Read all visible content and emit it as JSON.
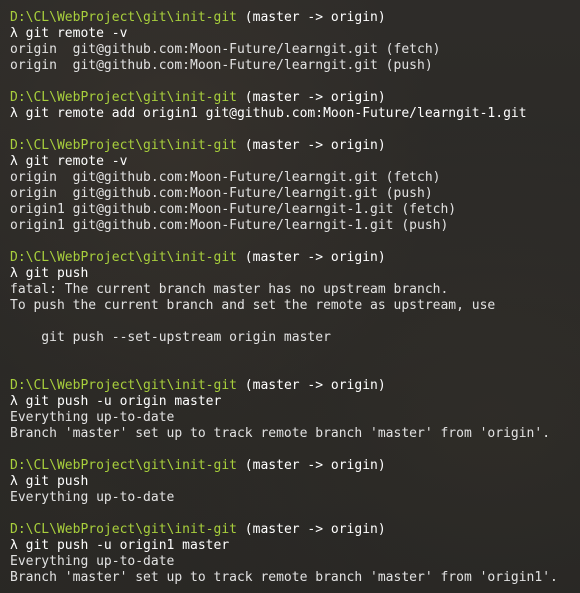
{
  "colors": {
    "background": "#2b2a28",
    "prompt_path": "#a8cf3c",
    "text": "#e8e8e8"
  },
  "lines": [
    {
      "type": "prompt",
      "path": "D:\\CL\\WebProject\\git\\init-git",
      "branch": " (master -> origin)"
    },
    {
      "type": "command",
      "text": "λ git remote -v"
    },
    {
      "type": "output",
      "text": "origin  git@github.com:Moon-Future/learngit.git (fetch)"
    },
    {
      "type": "output",
      "text": "origin  git@github.com:Moon-Future/learngit.git (push)"
    },
    {
      "type": "blank",
      "text": ""
    },
    {
      "type": "prompt",
      "path": "D:\\CL\\WebProject\\git\\init-git",
      "branch": " (master -> origin)"
    },
    {
      "type": "command",
      "text": "λ git remote add origin1 git@github.com:Moon-Future/learngit-1.git"
    },
    {
      "type": "blank",
      "text": ""
    },
    {
      "type": "prompt",
      "path": "D:\\CL\\WebProject\\git\\init-git",
      "branch": " (master -> origin)"
    },
    {
      "type": "command",
      "text": "λ git remote -v"
    },
    {
      "type": "output",
      "text": "origin  git@github.com:Moon-Future/learngit.git (fetch)"
    },
    {
      "type": "output",
      "text": "origin  git@github.com:Moon-Future/learngit.git (push)"
    },
    {
      "type": "output",
      "text": "origin1 git@github.com:Moon-Future/learngit-1.git (fetch)"
    },
    {
      "type": "output",
      "text": "origin1 git@github.com:Moon-Future/learngit-1.git (push)"
    },
    {
      "type": "blank",
      "text": ""
    },
    {
      "type": "prompt",
      "path": "D:\\CL\\WebProject\\git\\init-git",
      "branch": " (master -> origin)"
    },
    {
      "type": "command",
      "text": "λ git push"
    },
    {
      "type": "output",
      "text": "fatal: The current branch master has no upstream branch."
    },
    {
      "type": "output",
      "text": "To push the current branch and set the remote as upstream, use"
    },
    {
      "type": "blank",
      "text": ""
    },
    {
      "type": "output",
      "text": "    git push --set-upstream origin master"
    },
    {
      "type": "blank",
      "text": ""
    },
    {
      "type": "blank",
      "text": ""
    },
    {
      "type": "prompt",
      "path": "D:\\CL\\WebProject\\git\\init-git",
      "branch": " (master -> origin)"
    },
    {
      "type": "command",
      "text": "λ git push -u origin master"
    },
    {
      "type": "output",
      "text": "Everything up-to-date"
    },
    {
      "type": "output",
      "text": "Branch 'master' set up to track remote branch 'master' from 'origin'."
    },
    {
      "type": "blank",
      "text": ""
    },
    {
      "type": "prompt",
      "path": "D:\\CL\\WebProject\\git\\init-git",
      "branch": " (master -> origin)"
    },
    {
      "type": "command",
      "text": "λ git push"
    },
    {
      "type": "output",
      "text": "Everything up-to-date"
    },
    {
      "type": "blank",
      "text": ""
    },
    {
      "type": "prompt",
      "path": "D:\\CL\\WebProject\\git\\init-git",
      "branch": " (master -> origin)"
    },
    {
      "type": "command",
      "text": "λ git push -u origin1 master"
    },
    {
      "type": "output",
      "text": "Everything up-to-date"
    },
    {
      "type": "output",
      "text": "Branch 'master' set up to track remote branch 'master' from 'origin1'."
    }
  ]
}
